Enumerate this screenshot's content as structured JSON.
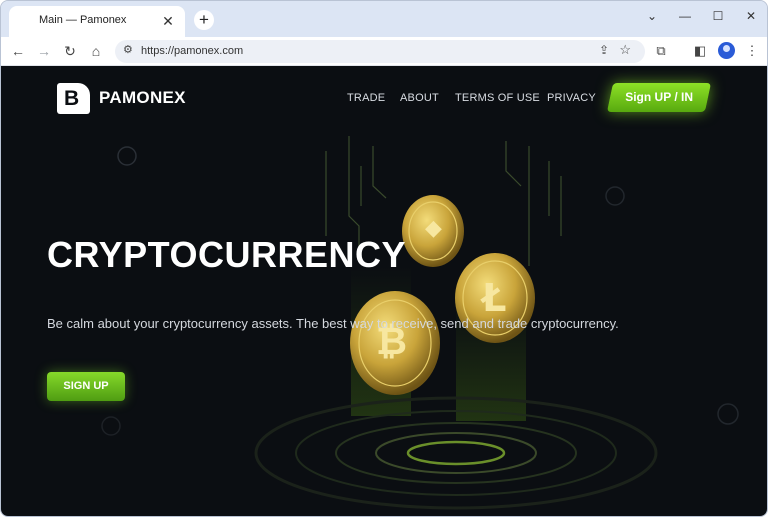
{
  "browser": {
    "tab_title": "Main — Pamonex",
    "tab_close": "✕",
    "new_tab": "+",
    "address": "https://pamonex.com",
    "controls": {
      "collapse": "⌄",
      "minimize": "—",
      "maximize": "☐",
      "close": "✕"
    }
  },
  "site": {
    "brand": "PAMONEX",
    "logo_letter": "B",
    "nav": [
      "TRADE",
      "ABOUT",
      "TERMS OF USE",
      "PRIVACY"
    ],
    "signup_nav": "Sign UP / IN",
    "hero_title": "CRYPTOCURRENCY",
    "hero_subtitle": "Be calm about your cryptocurrency assets. The best way to receive, send and trade cryptocurrency.",
    "hero_button": "SIGN UP",
    "coin_glyphs": {
      "ethereum": "◆",
      "litecoin": "Ł",
      "bitcoin": "₿"
    }
  },
  "colors": {
    "accent": "#7ed321",
    "page_bg": "#0b0e12",
    "coin_gold": "#c9a43a"
  }
}
